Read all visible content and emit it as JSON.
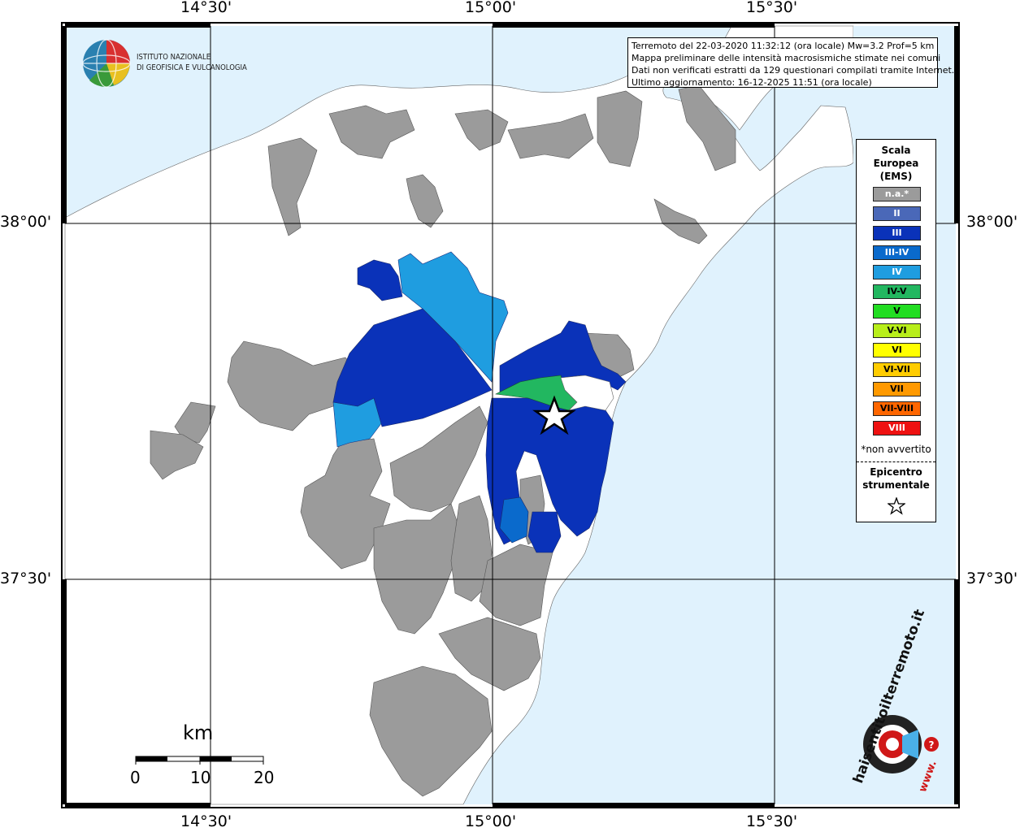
{
  "map": {
    "lon_labels": [
      "14°30'",
      "15°00'",
      "15°30'"
    ],
    "lat_labels": [
      "38°00'",
      "37°30'"
    ]
  },
  "org": {
    "line1": "ISTITUTO NAZIONALE",
    "line2": "DI GEOFISICA E VULCANOLOGIA"
  },
  "info": {
    "line1": "Terremoto del 22-03-2020 11:32:12 (ora locale) Mw=3.2 Prof=5 km",
    "line2": "Mappa preliminare delle intensità macrosismiche stimate nei comuni",
    "line3": "Dati non verificati estratti da 129 questionari compilati tramite Internet.",
    "line4": "Ultimo aggiornamento: 16-12-2025 11:51 (ora locale)"
  },
  "legend": {
    "title1": "Scala",
    "title2": "Europea",
    "title3": "(EMS)",
    "items": [
      {
        "label": "n.a.*",
        "color": "#9b9b9b",
        "text": "#ffffff"
      },
      {
        "label": "II",
        "color": "#4a68b8",
        "text": "#ffffff"
      },
      {
        "label": "III",
        "color": "#0a32b9",
        "text": "#ffffff"
      },
      {
        "label": "III-IV",
        "color": "#0a6acc",
        "text": "#ffffff"
      },
      {
        "label": "IV",
        "color": "#1f9de0",
        "text": "#ffffff"
      },
      {
        "label": "IV-V",
        "color": "#22b760",
        "text": "#000000"
      },
      {
        "label": "V",
        "color": "#22dd22",
        "text": "#000000"
      },
      {
        "label": "V-VI",
        "color": "#b8ee1a",
        "text": "#000000"
      },
      {
        "label": "VI",
        "color": "#ffff00",
        "text": "#000000"
      },
      {
        "label": "VI-VII",
        "color": "#ffcc00",
        "text": "#000000"
      },
      {
        "label": "VII",
        "color": "#ff9900",
        "text": "#000000"
      },
      {
        "label": "VII-VIII",
        "color": "#ff6600",
        "text": "#000000"
      },
      {
        "label": "VIII",
        "color": "#ee1111",
        "text": "#ffffff"
      }
    ],
    "note": "*non avvertito",
    "epicenter1": "Epicentro",
    "epicenter2": "strumentale"
  },
  "scale": {
    "unit": "km",
    "ticks": [
      "0",
      "10",
      "20"
    ]
  },
  "brand": {
    "text": "haisentitoilterremoto.it",
    "url": "www."
  },
  "colors": {
    "sea": "#e0f2fd",
    "land": "#ffffff",
    "na": "#9b9b9b",
    "ii": "#4a68b8",
    "iii": "#0a32b9",
    "iv": "#1f9de0",
    "iv_v": "#22b760"
  }
}
